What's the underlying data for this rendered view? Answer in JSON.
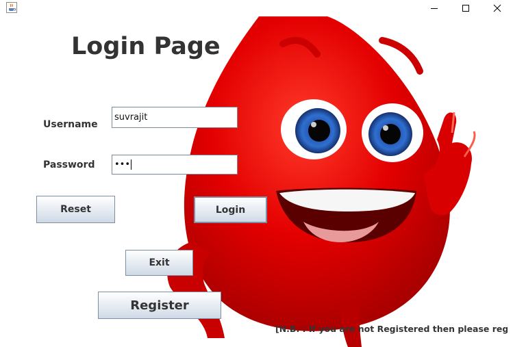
{
  "window": {
    "icon": "java-cup-icon",
    "controls": {
      "minimize": "minimize-icon",
      "maximize": "maximize-icon",
      "close": "close-icon"
    }
  },
  "page": {
    "title": "Login Page",
    "username_label": "Username",
    "password_label": "Password",
    "username_value": "suvrajit",
    "password_masked": "•••",
    "reset_label": "Reset",
    "login_label": "Login",
    "exit_label": "Exit",
    "register_label": "Register",
    "note": "[N.B. : If you are not Registered then please register ]"
  },
  "background": {
    "illustration": "blood-drop-mascot",
    "color": "#e00000"
  }
}
